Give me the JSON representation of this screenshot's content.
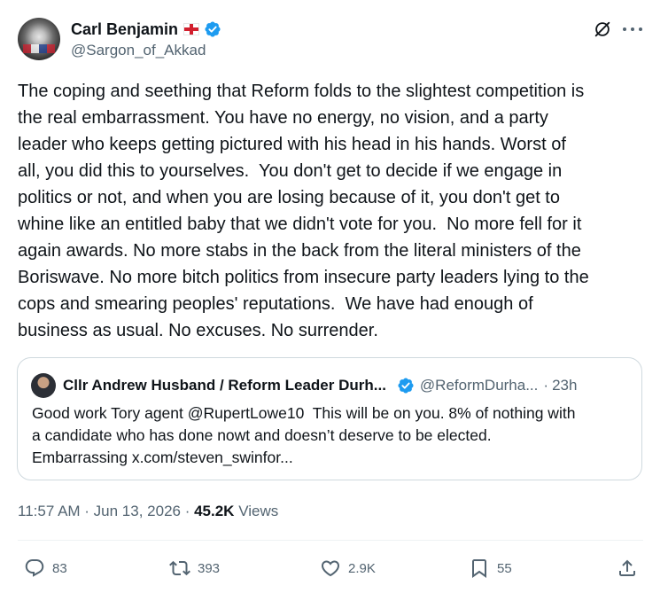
{
  "author": {
    "display_name": "Carl Benjamin",
    "flag": "england-flag-icon",
    "verified": true,
    "handle": "@Sargon_of_Akkad"
  },
  "tweet": {
    "text": "The coping and seething that Reform folds to the slightest competition is\nthe real embarrassment. You have no energy, no vision, and a party\nleader who keeps getting pictured with his head in his hands. Worst of\nall, you did this to yourselves.  You don't get to decide if we engage in\npolitics or not, and when you are losing because of it, you don't get to\nwhine like an entitled baby that we didn't vote for you.  No more fell for it\nagain awards. No more stabs in the back from the literal ministers of the\nBoriswave. No more bitch politics from insecure party leaders lying to the\ncops and smearing peoples' reputations.  We have had enough of\nbusiness as usual. No excuses. No surrender."
  },
  "quoted_tweet": {
    "display_name": "Cllr Andrew Husband / Reform Leader Durh...",
    "verified": true,
    "handle": "@ReformDurha...",
    "separator": "·",
    "time": "23h",
    "text": "Good work Tory agent @RupertLowe10  This will be on you. 8% of nothing with\na candidate who has done nowt and doesn’t deserve to be elected.\nEmbarrassing x.com/steven_swinfor..."
  },
  "meta": {
    "timestamp": "11:57 AM · Jun 13, 2026 · ",
    "views_count": "45.2K",
    "views_label": " Views"
  },
  "actions": {
    "replies": "83",
    "reposts": "393",
    "likes": "2.9K",
    "bookmarks": "55"
  },
  "colors": {
    "verified": "#1d9bf0",
    "text": "#0f1419",
    "secondary": "#536471",
    "border": "#cfd9de"
  }
}
